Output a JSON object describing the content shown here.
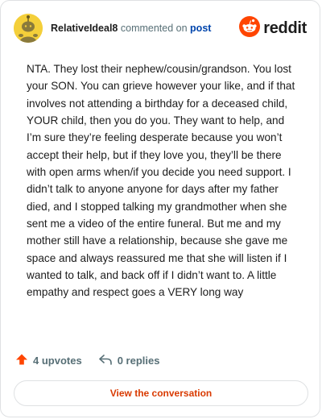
{
  "header": {
    "username": "RelativeIdeal8",
    "commented_on": "commented on",
    "post_link": "post",
    "logo_text": "reddit"
  },
  "comment": {
    "text": "NTA. They lost their nephew/cousin/grandson. You lost your SON. You can grieve however your like, and if that involves not attending a birthday for a deceased child, YOUR child, then you do you. They want to help, and I’m sure they’re feeling desperate because you won’t accept their help, but if they love you, they’ll be there with open arms when/if you decide you need support. I didn’t talk to anyone anyone for days after my father died, and I stopped talking my grandmother when she sent me a video of the entire funeral. But me and my mother still have a relationship, because she gave me space and always reassured me that she will listen if I wanted to talk, and back off if I didn’t want to. A little empathy and respect goes a VERY long way"
  },
  "actions": {
    "upvotes_label": "4 upvotes",
    "replies_label": "0 replies"
  },
  "cta": {
    "label": "View the conversation"
  },
  "icons": {
    "avatar": "avatar-icon",
    "logo": "reddit-logo-icon",
    "upvote": "upvote-arrow-icon",
    "reply": "reply-arrow-icon"
  },
  "colors": {
    "reddit_orange": "#ff4500",
    "link_blue": "#0045ac",
    "cta_text": "#d93a00",
    "meta_gray": "#576f76",
    "avatar_yellow": "#f4cf3a"
  }
}
